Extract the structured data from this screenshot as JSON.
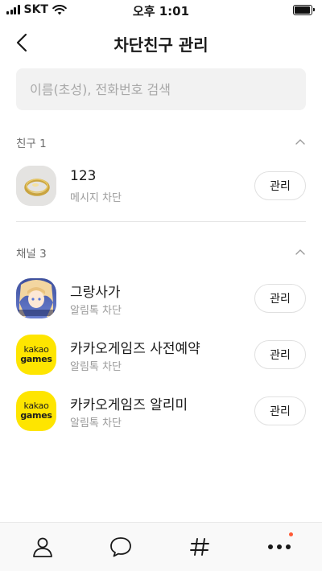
{
  "status_bar": {
    "carrier": "SKT",
    "time": "오후 1:01"
  },
  "header": {
    "title": "차단친구 관리"
  },
  "search": {
    "placeholder": "이름(초성), 전화번호 검색",
    "value": ""
  },
  "sections": {
    "friends": {
      "title": "친구 1",
      "items": [
        {
          "name": "123",
          "status": "메시지 차단",
          "button": "관리",
          "avatar_icon": "ring-photo"
        }
      ]
    },
    "channels": {
      "title": "채널 3",
      "items": [
        {
          "name": "그랑사가",
          "status": "알림톡 차단",
          "button": "관리",
          "avatar_icon": "anime-character-logo",
          "avatar_text": "GranSaga"
        },
        {
          "name": "카카오게임즈 사전예약",
          "status": "알림톡 차단",
          "button": "관리",
          "avatar_icon": "kakao-games-logo",
          "logo_line1": "kakao",
          "logo_line2": "games"
        },
        {
          "name": "카카오게임즈 알리미",
          "status": "알림톡 차단",
          "button": "관리",
          "avatar_icon": "kakao-games-logo",
          "logo_line1": "kakao",
          "logo_line2": "games"
        }
      ]
    }
  },
  "tabbar": {
    "items": [
      {
        "icon": "person-icon"
      },
      {
        "icon": "chat-bubble-icon"
      },
      {
        "icon": "hashtag-icon"
      },
      {
        "icon": "more-icon",
        "has_badge": true
      }
    ]
  },
  "colors": {
    "kakao_yellow": "#fee500",
    "badge": "#ff5a36",
    "search_bg": "#f2f2f2"
  }
}
